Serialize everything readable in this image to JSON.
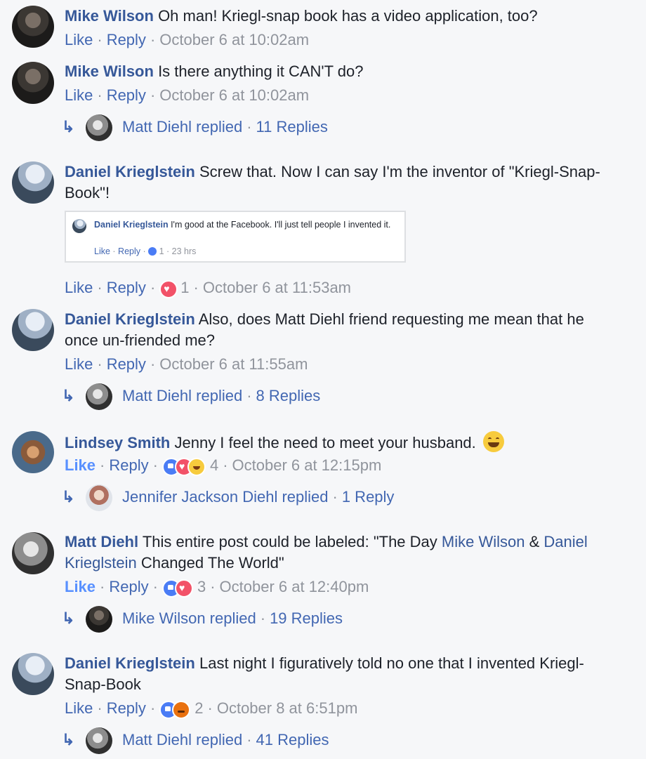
{
  "comments": [
    {
      "author": "Mike Wilson",
      "text": "Oh man! Kriegl-snap book has a video application, too?",
      "like": "Like",
      "reply": "Reply",
      "time": "October 6 at 10:02am"
    },
    {
      "author": "Mike Wilson",
      "text": "Is there anything it CAN'T do?",
      "like": "Like",
      "reply": "Reply",
      "time": "October 6 at 10:02am",
      "replies": {
        "who": "Matt Diehl replied",
        "count": "11 Replies"
      }
    },
    {
      "author": "Daniel Krieglstein",
      "text": "Screw that. Now I can say I'm the inventor of \"Kriegl-Snap-Book\"!",
      "quoted": {
        "author": "Daniel Krieglstein",
        "text": "I'm good at the Facebook. I'll just tell people I invented it.",
        "like": "Like",
        "reply": "Reply",
        "reactions": "1",
        "time": "23 hrs"
      },
      "like": "Like",
      "reply": "Reply",
      "reactions": "1",
      "time": "October 6 at 11:53am"
    },
    {
      "author": "Daniel Krieglstein",
      "text": "Also, does Matt Diehl friend requesting me mean that he once un-friended me?",
      "like": "Like",
      "reply": "Reply",
      "time": "October 6 at 11:55am",
      "replies": {
        "who": "Matt Diehl replied",
        "count": "8 Replies"
      }
    },
    {
      "author": "Lindsey Smith",
      "text": "Jenny I feel the need to meet your husband.",
      "like": "Like",
      "reply": "Reply",
      "reactions": "4",
      "time": "October 6 at 12:15pm",
      "replies": {
        "who": "Jennifer Jackson Diehl replied",
        "count": "1 Reply"
      }
    },
    {
      "author": "Matt Diehl",
      "text_before": "This entire post could be labeled: \"The Day ",
      "mention1": "Mike Wilson",
      "text_mid": " & ",
      "mention2": "Daniel Krieglstein",
      "text_after": " Changed The World\"",
      "like": "Like",
      "reply": "Reply",
      "reactions": "3",
      "time": "October 6 at 12:40pm",
      "replies": {
        "who": "Mike Wilson replied",
        "count": "19 Replies"
      }
    },
    {
      "author": "Daniel Krieglstein",
      "text": "Last night I figuratively told no one that I invented Kriegl-Snap-Book",
      "like": "Like",
      "reply": "Reply",
      "reactions": "2",
      "time": "October 8 at 6:51pm",
      "replies": {
        "who": "Matt Diehl replied",
        "count": "41 Replies"
      }
    }
  ],
  "separator": "·",
  "reply_arrow_icon": "reply-arrow-icon",
  "colors": {
    "link": "#365899",
    "action": "#4267b2",
    "meta": "#90949c",
    "liked": "#5890ff",
    "background": "#f6f7f9"
  }
}
